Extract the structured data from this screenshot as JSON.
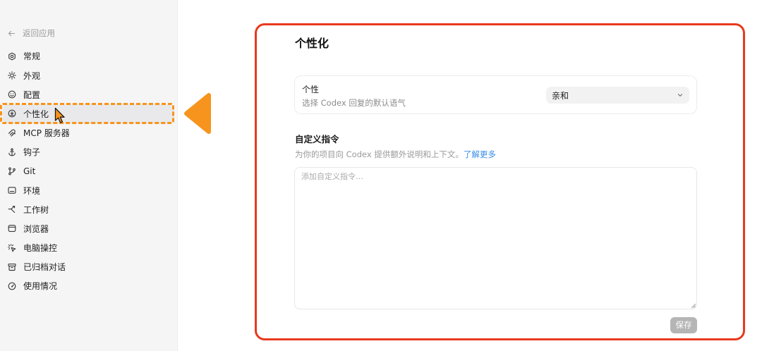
{
  "sidebar": {
    "back_label": "返回应用",
    "back_icon": "back-arrow-icon",
    "items": [
      {
        "label": "常规",
        "icon": "gear-icon"
      },
      {
        "label": "外观",
        "icon": "sun-icon"
      },
      {
        "label": "配置",
        "icon": "smiley-icon"
      },
      {
        "label": "个性化",
        "icon": "personalization-icon",
        "selected": true
      },
      {
        "label": "MCP 服务器",
        "icon": "mcp-icon"
      },
      {
        "label": "钩子",
        "icon": "anchor-icon"
      },
      {
        "label": "Git",
        "icon": "git-branch-icon"
      },
      {
        "label": "环境",
        "icon": "terminal-window-icon"
      },
      {
        "label": "工作树",
        "icon": "worktree-icon"
      },
      {
        "label": "浏览器",
        "icon": "browser-icon"
      },
      {
        "label": "电脑操控",
        "icon": "computer-control-icon"
      },
      {
        "label": "已归档对话",
        "icon": "archive-icon"
      },
      {
        "label": "使用情况",
        "icon": "gauge-icon"
      }
    ]
  },
  "main": {
    "title": "个性化",
    "personality": {
      "label": "个性",
      "description": "选择 Codex 回复的默认语气",
      "selected_value": "亲和",
      "dropdown_icon": "chevron-down-icon"
    },
    "custom_instructions": {
      "heading": "自定义指令",
      "description": "为你的项目向 Codex 提供额外说明和上下文。",
      "link_label": "了解更多",
      "placeholder": "添加自定义指令…"
    },
    "save_label": "保存"
  },
  "colors": {
    "sidebar-bg": "#f5f5f6",
    "selected-bg": "#e9e9eb",
    "link-blue": "#3b8ce8",
    "save-button-bg": "#b5b5b5",
    "annotation-orange": "#f7941d",
    "annotation-red": "#e8391e"
  }
}
